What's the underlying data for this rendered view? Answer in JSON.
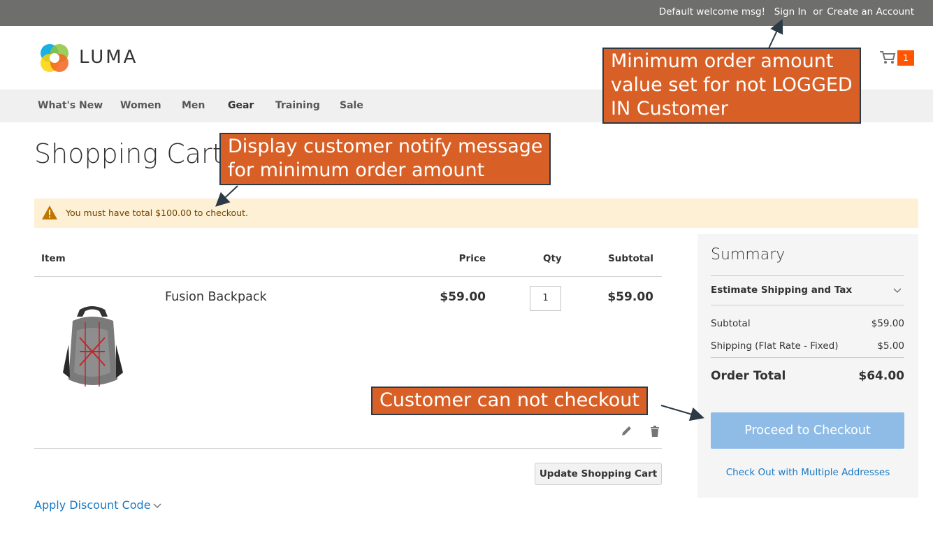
{
  "topbar": {
    "welcome": "Default welcome msg!",
    "signin": "Sign In",
    "or": "or",
    "create": "Create an Account"
  },
  "header": {
    "logo_text": "LUMA",
    "cart_count": "1"
  },
  "nav": {
    "items": [
      "What's New",
      "Women",
      "Men",
      "Gear",
      "Training",
      "Sale"
    ]
  },
  "page": {
    "title": "Shopping Cart",
    "warning": "You must have total $100.00 to checkout."
  },
  "table": {
    "headers": {
      "item": "Item",
      "price": "Price",
      "qty": "Qty",
      "subtotal": "Subtotal"
    },
    "rows": [
      {
        "name": "Fusion Backpack",
        "price": "$59.00",
        "qty": "1",
        "subtotal": "$59.00"
      }
    ]
  },
  "actions": {
    "update_cart": "Update Shopping Cart",
    "apply_discount": "Apply Discount Code"
  },
  "summary": {
    "title": "Summary",
    "estimate": "Estimate Shipping and Tax",
    "subtotal_label": "Subtotal",
    "subtotal_value": "$59.00",
    "shipping_label": "Shipping (Flat Rate - Fixed)",
    "shipping_value": "$5.00",
    "total_label": "Order Total",
    "total_value": "$64.00",
    "checkout": "Proceed to Checkout",
    "multi": "Check Out with Multiple Addresses"
  },
  "annotations": {
    "min_order": [
      "Minimum order amount",
      "value set for not LOGGED",
      "IN Customer"
    ],
    "notify": [
      "Display customer notify message",
      "for minimum order amount"
    ],
    "no_checkout": "Customer can not checkout"
  },
  "colors": {
    "topbar": "#6e6e6c",
    "accent": "#ff5501",
    "link": "#1979c3",
    "callout": "#d86027",
    "checkout_disabled": "#8fbce6",
    "warning_bg": "#fdf0d5"
  }
}
